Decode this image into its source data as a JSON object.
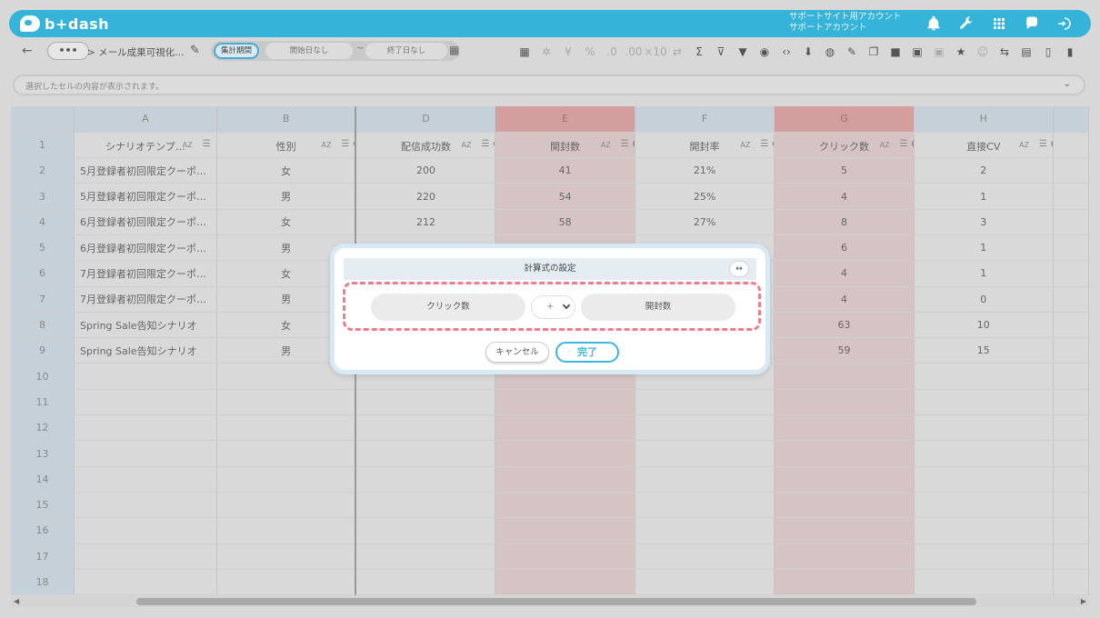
{
  "header": {
    "logo_text": "b+dash",
    "account_line1": "サポートサイト用アカウント",
    "account_line2": "サポートアカウント"
  },
  "toolbar": {
    "back": "←",
    "more": "•••",
    "breadcrumb": "> メール成果可視化…",
    "period_label": "集計期間",
    "start_date": "開始日なし",
    "tilde": "~",
    "end_date": "終了日なし",
    "icons": [
      "table-icon",
      "sparkle-icon",
      "yen-icon",
      "percent-icon",
      "decimal-down-icon",
      "decimal-up-icon",
      "multiply-icon",
      "transpose-icon",
      "sum-icon",
      "filter-remove-icon",
      "filter-icon",
      "eye-icon",
      "code-icon",
      "download-icon",
      "chart-icon",
      "edit-icon",
      "copy-icon",
      "trash-icon",
      "archive-icon",
      "archive-dim-icon",
      "star-icon",
      "user-icon",
      "sync-icon",
      "calendar-icon",
      "document-icon",
      "clipboard-icon"
    ]
  },
  "cellbar": {
    "placeholder": "選択したセルの内容が表示されます。",
    "caret": "⌄"
  },
  "grid": {
    "columns": [
      "A",
      "B",
      "D",
      "E",
      "F",
      "G",
      "H"
    ],
    "highlighted_columns": [
      "E",
      "G"
    ],
    "field_headers": [
      "シナリオテンプ…",
      "性別",
      "配信成功数",
      "開封数",
      "開封率",
      "クリック数",
      "直接CV"
    ],
    "rows": [
      {
        "num": "1"
      },
      {
        "num": "2",
        "cells": [
          "5月登録者初回限定クーポ…",
          "女",
          "200",
          "41",
          "21%",
          "5",
          "2"
        ]
      },
      {
        "num": "3",
        "cells": [
          "5月登録者初回限定クーポ…",
          "男",
          "220",
          "54",
          "25%",
          "4",
          "1"
        ]
      },
      {
        "num": "4",
        "cells": [
          "6月登録者初回限定クーポ…",
          "女",
          "212",
          "58",
          "27%",
          "8",
          "3"
        ]
      },
      {
        "num": "5",
        "cells": [
          "6月登録者初回限定クーポ…",
          "男",
          "",
          "",
          "",
          "6",
          "1"
        ]
      },
      {
        "num": "6",
        "cells": [
          "7月登録者初回限定クーポ…",
          "女",
          "",
          "",
          "",
          "4",
          "1"
        ]
      },
      {
        "num": "7",
        "cells": [
          "7月登録者初回限定クーポ…",
          "男",
          "",
          "",
          "",
          "4",
          "0"
        ]
      },
      {
        "num": "8",
        "cells": [
          "Spring Sale告知シナリオ",
          "女",
          "",
          "",
          "",
          "63",
          "10"
        ]
      },
      {
        "num": "9",
        "cells": [
          "Spring Sale告知シナリオ",
          "男",
          "",
          "",
          "",
          "59",
          "15"
        ]
      },
      {
        "num": "10"
      },
      {
        "num": "11"
      },
      {
        "num": "12"
      },
      {
        "num": "13"
      },
      {
        "num": "14"
      },
      {
        "num": "15"
      },
      {
        "num": "16"
      },
      {
        "num": "17"
      },
      {
        "num": "18"
      }
    ]
  },
  "dialog": {
    "title": "計算式の設定",
    "expand": "↔",
    "left_operand": "クリック数",
    "operator": "+",
    "right_operand": "開封数",
    "cancel": "キャンセル",
    "ok": "完了"
  },
  "colors": {
    "header": "#35b3d8",
    "highlight_col": "#d39e9e",
    "dashed_border": "#f07c8c",
    "ok_button": "#3ab6e0"
  }
}
